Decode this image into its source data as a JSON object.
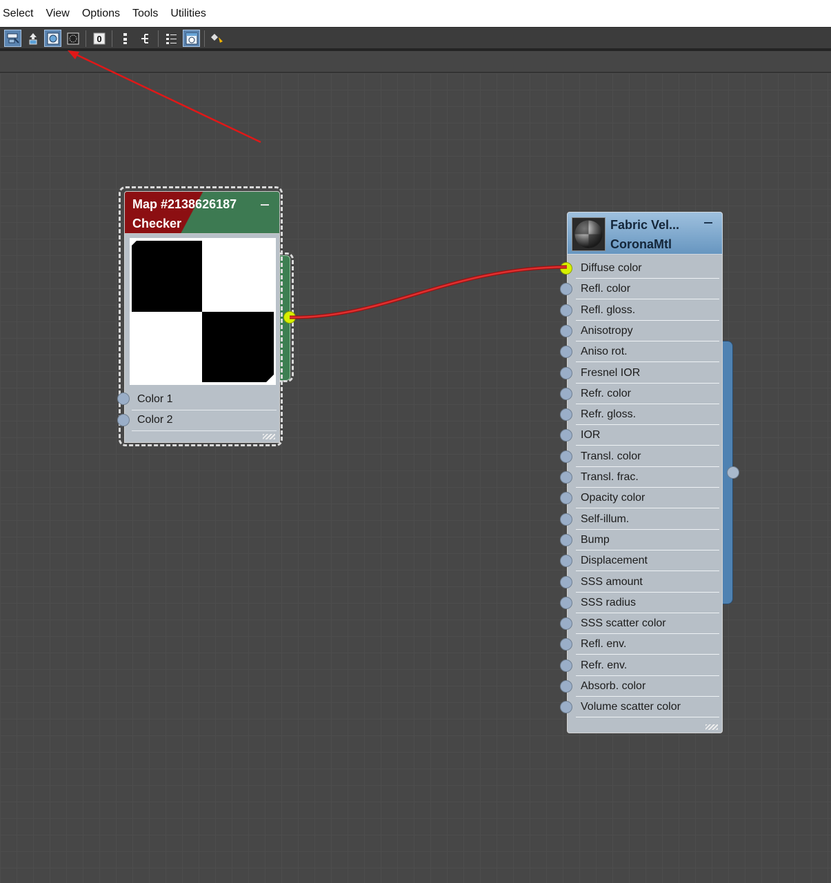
{
  "menubar": {
    "items": [
      "Select",
      "View",
      "Options",
      "Tools",
      "Utilities"
    ]
  },
  "toolbar": {
    "buttons": [
      {
        "icon": "select-tool-icon",
        "active": true
      },
      {
        "icon": "move-children-icon",
        "active": false
      },
      {
        "icon": "show-map-in-viewport-icon",
        "active": true
      },
      {
        "icon": "show-background-icon",
        "active": false
      },
      {
        "icon": "hide-unused-slots-icon",
        "active": false
      },
      {
        "icon": "layout-vertical-icon",
        "active": false
      },
      {
        "icon": "layout-horizontal-icon",
        "active": false
      },
      {
        "icon": "layout-children-icon",
        "active": false
      },
      {
        "icon": "parameter-editor-icon",
        "active": true
      },
      {
        "icon": "material-map-browser-icon",
        "active": false
      }
    ]
  },
  "annotation": {
    "color": "#e01818",
    "points_to": "show-map-in-viewport-icon"
  },
  "checker_node": {
    "title": "Map #2138626187",
    "type": "Checker",
    "header_color_left": "#8c0f12",
    "header_color_right": "#3d7a52",
    "slots": [
      "Color 1",
      "Color 2"
    ],
    "selected": true
  },
  "material_node": {
    "title": "Fabric Vel...",
    "type": "CoronaMtl",
    "header_color": "#7aa6cf",
    "slots": [
      "Diffuse color",
      "Refl. color",
      "Refl. gloss.",
      "Anisotropy",
      "Aniso rot.",
      "Fresnel IOR",
      "Refr. color",
      "Refr. gloss.",
      "IOR",
      "Transl. color",
      "Transl. frac.",
      "Opacity color",
      "Self-illum.",
      "Bump",
      "Displacement",
      "SSS amount",
      "SSS radius",
      "SSS scatter color",
      "Refl. env.",
      "Refr. env.",
      "Absorb. color",
      "Volume scatter color"
    ],
    "connected_slot": "Diffuse color"
  },
  "wire": {
    "from": "Checker",
    "to": "Diffuse color",
    "color": "#d42020"
  }
}
